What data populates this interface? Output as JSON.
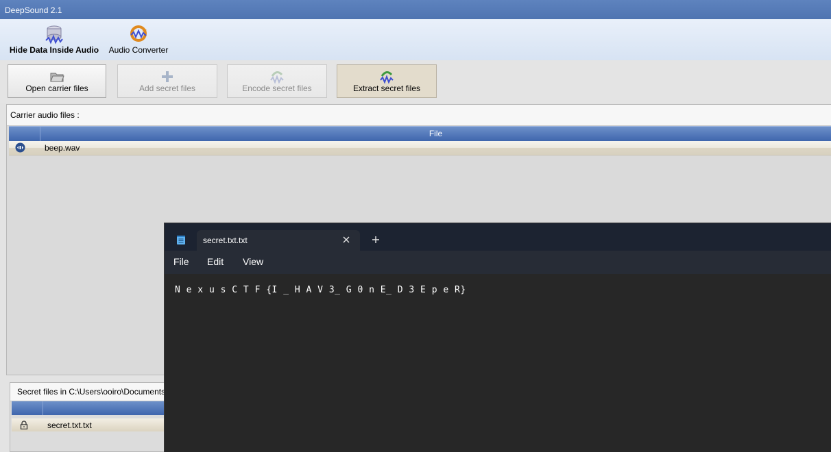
{
  "deepsound": {
    "title": "DeepSound 2.1",
    "ribbon": {
      "hide_data_label": "Hide Data Inside Audio",
      "audio_converter_label": "Audio Converter"
    },
    "toolbar": {
      "open_carrier_label": "Open carrier files",
      "add_secret_label": "Add secret files",
      "encode_secret_label": "Encode secret files",
      "extract_secret_label": "Extract secret files"
    },
    "carrier": {
      "header": "Carrier audio files :",
      "column_file": "File",
      "rows": [
        {
          "name": "beep.wav"
        }
      ]
    },
    "secret": {
      "header": "Secret files in C:\\Users\\ooiro\\Documents",
      "rows": [
        {
          "name": "secret.txt.txt"
        }
      ]
    }
  },
  "notepad": {
    "tab_title": "secret.txt.txt",
    "menu": {
      "file": "File",
      "edit": "Edit",
      "view": "View"
    },
    "content": "N e x u s C T F {I _ H A V 3_ G 0 n E_ D 3 E p e R}"
  },
  "colors": {
    "title_bar": "#5e83be",
    "table_header": "#4f74b5",
    "notepad_bg": "#272727",
    "notepad_tabbar": "#1c2331"
  }
}
